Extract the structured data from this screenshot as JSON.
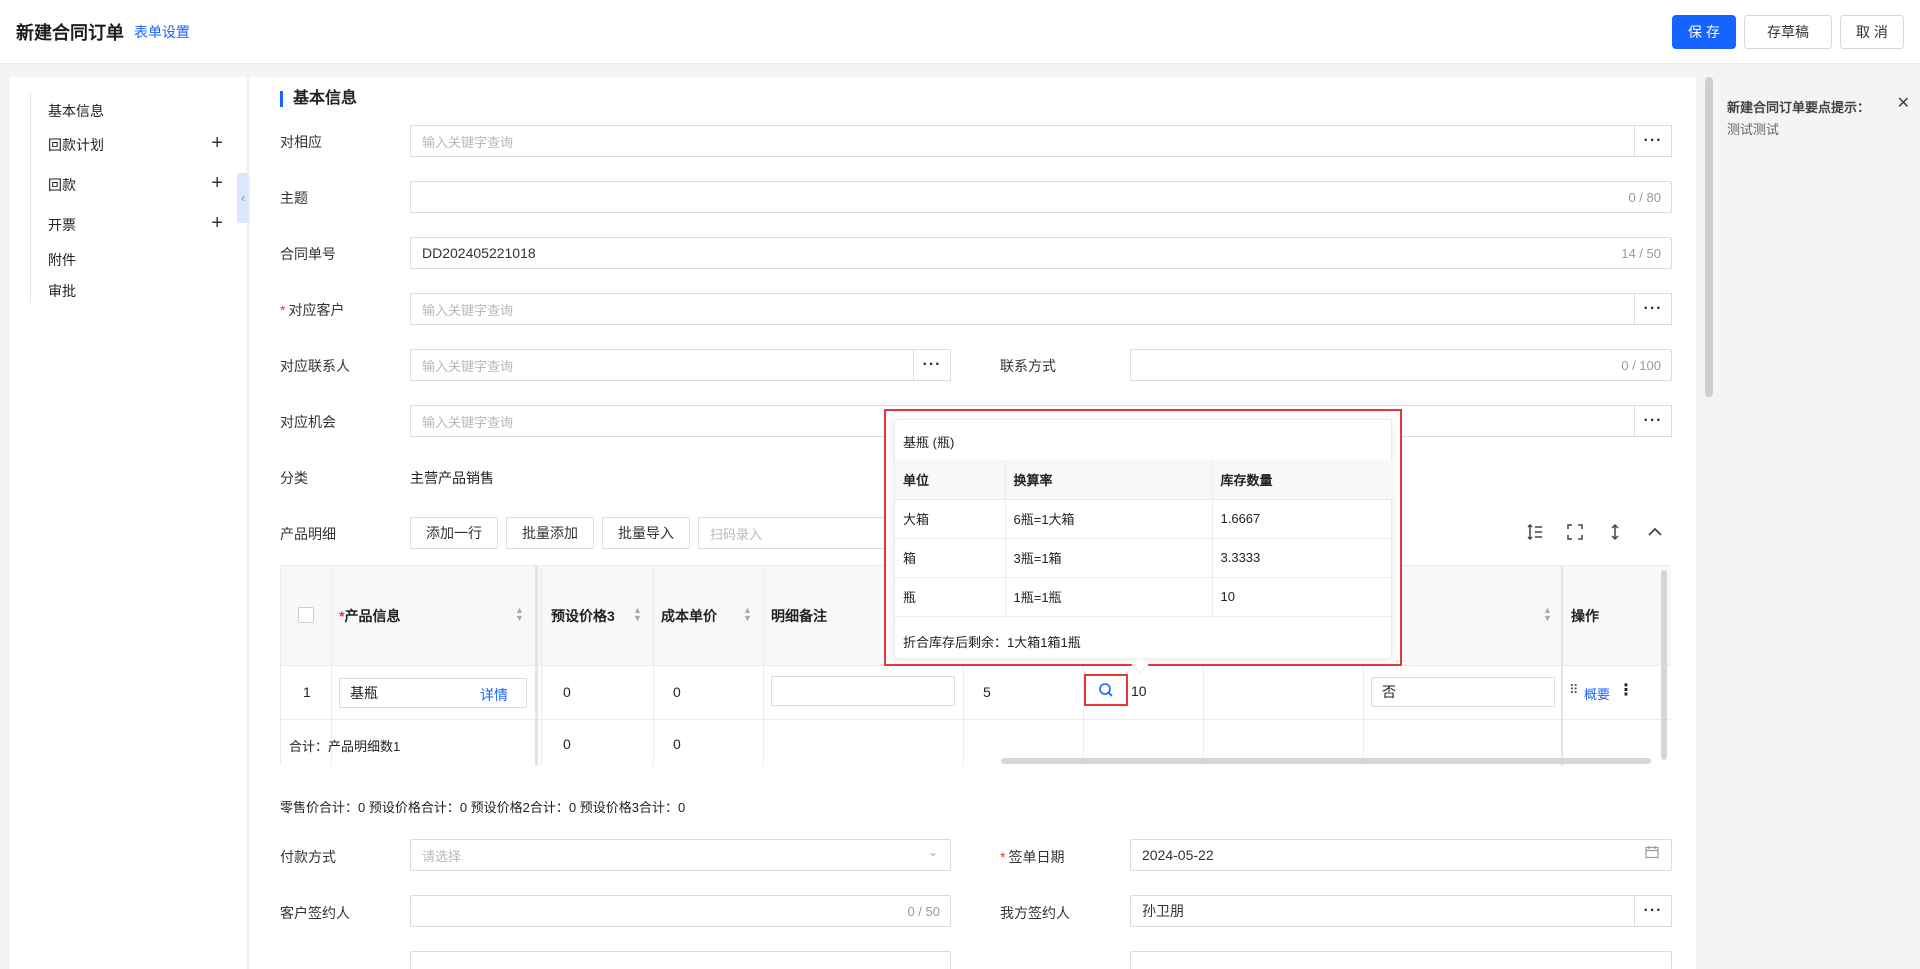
{
  "header": {
    "title": "新建合同订单",
    "form_settings": "表单设置",
    "save": "保 存",
    "save_draft": "存草稿",
    "cancel": "取 消"
  },
  "sidebar": {
    "items": [
      {
        "label": "基本信息",
        "has_add": false
      },
      {
        "label": "回款计划",
        "has_add": true
      },
      {
        "label": "回款",
        "has_add": true
      },
      {
        "label": "开票",
        "has_add": true
      },
      {
        "label": "附件",
        "has_add": false
      },
      {
        "label": "审批",
        "has_add": false
      }
    ],
    "add_symbol": "+"
  },
  "section": {
    "title": "基本信息"
  },
  "form": {
    "match": {
      "label": "对相应",
      "placeholder": "输入关键字查询"
    },
    "subject": {
      "label": "主题",
      "count": "0 / 80"
    },
    "contract_no": {
      "label": "合同单号",
      "value": "DD202405221018",
      "count": "14 / 50"
    },
    "customer": {
      "label": "对应客户",
      "placeholder": "输入关键字查询",
      "required": "*"
    },
    "contact": {
      "label": "对应联系人",
      "placeholder": "输入关键字查询"
    },
    "contact_method": {
      "label": "联系方式",
      "count": "0 / 100"
    },
    "opportunity": {
      "label": "对应机会",
      "placeholder": "输入关键字查询"
    },
    "category": {
      "label": "分类",
      "value": "主营产品销售"
    },
    "product_detail": {
      "label": "产品明细"
    },
    "payment_method": {
      "label": "付款方式",
      "placeholder": "请选择"
    },
    "sign_date": {
      "label": "签单日期",
      "value": "2024-05-22",
      "required": "*"
    },
    "customer_signer": {
      "label": "客户签约人",
      "count": "0 / 50"
    },
    "our_signer": {
      "label": "我方签约人",
      "value": "孙卫朋"
    },
    "more_glyph": "···"
  },
  "toolbar": {
    "add_row": "添加一行",
    "batch_add": "批量添加",
    "batch_import": "批量导入",
    "scan_placeholder": "扫码录入"
  },
  "table": {
    "headers": {
      "product_info": "产品信息",
      "preset_price3": "预设价格3",
      "cost_price": "成本单价",
      "detail_note": "明细备注",
      "action": "操作",
      "required_mark": "*"
    },
    "row": {
      "index": "1",
      "product": "基瓶",
      "detail_link": "详情",
      "preset_price3": "0",
      "cost_price": "0",
      "quantity": "5",
      "stock_value": "10",
      "flag": "否",
      "summary_link": "概要"
    },
    "total": {
      "label": "合计：产品明细数1",
      "preset_price3": "0",
      "cost_price": "0"
    }
  },
  "totals_line": "零售价合计：0  预设价格合计：0  预设价格2合计：0  预设价格3合计：0",
  "popup": {
    "title": "基瓶 (瓶)",
    "columns": [
      "单位",
      "换算率",
      "库存数量"
    ],
    "rows": [
      [
        "大箱",
        "6瓶=1大箱",
        "1.6667"
      ],
      [
        "箱",
        "3瓶=1箱",
        "3.3333"
      ],
      [
        "瓶",
        "1瓶=1瓶",
        "10"
      ]
    ],
    "footer": "折合库存后剩余：1大箱1箱1瓶"
  },
  "tip": {
    "title": "新建合同订单要点提示：",
    "text": "测试测试"
  },
  "colors": {
    "primary": "#1664ff",
    "required": "#e53935",
    "highlight": "#e53935"
  }
}
